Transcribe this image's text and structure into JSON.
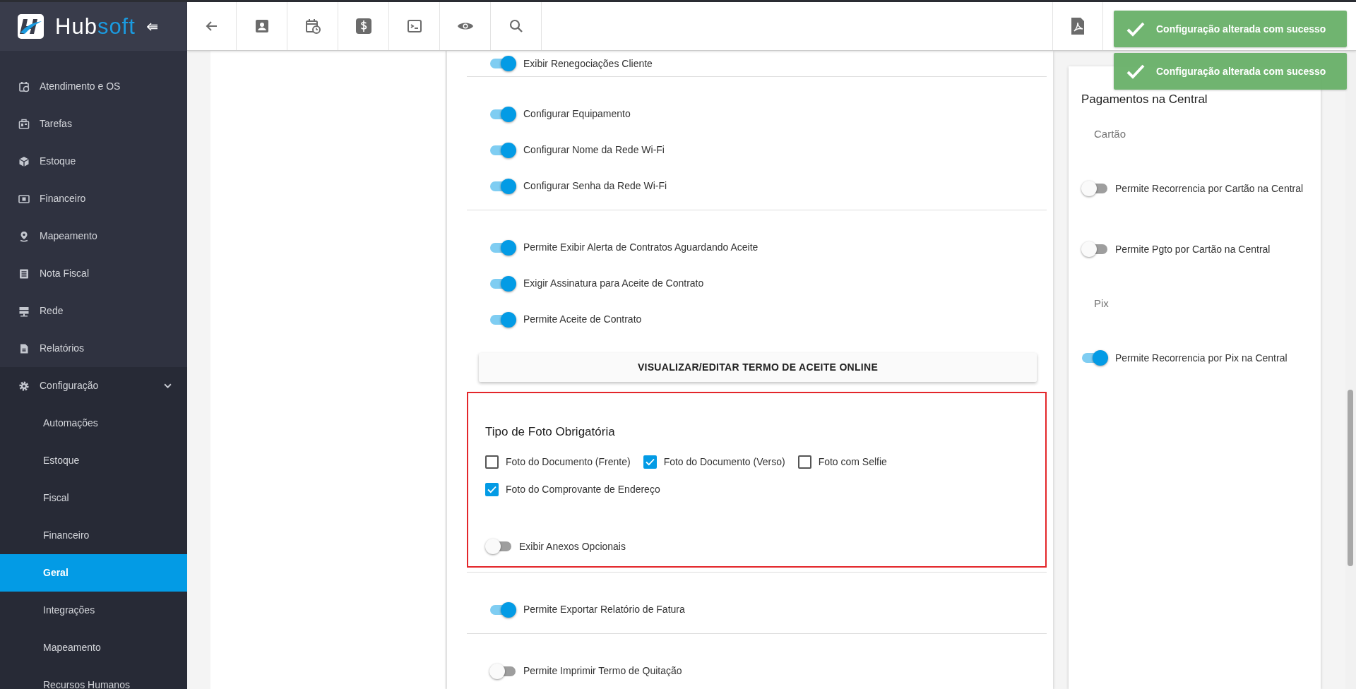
{
  "logo": {
    "part_1": "Hub",
    "part_2": "soft"
  },
  "sidebar": {
    "items": [
      {
        "label": "Atendimento e OS"
      },
      {
        "label": "Tarefas"
      },
      {
        "label": "Estoque"
      },
      {
        "label": "Financeiro"
      },
      {
        "label": "Mapeamento"
      },
      {
        "label": "Nota Fiscal"
      },
      {
        "label": "Rede"
      },
      {
        "label": "Relatórios"
      },
      {
        "label": "Configuração",
        "expanded": true,
        "children": [
          {
            "label": "Automações",
            "selected": false
          },
          {
            "label": "Estoque",
            "selected": false
          },
          {
            "label": "Fiscal",
            "selected": false
          },
          {
            "label": "Financeiro",
            "selected": false
          },
          {
            "label": "Geral",
            "selected": true
          },
          {
            "label": "Integrações",
            "selected": false
          },
          {
            "label": "Mapeamento",
            "selected": false
          },
          {
            "label": "Recursos Humanos",
            "selected": false
          }
        ]
      }
    ]
  },
  "toasts": [
    {
      "message": "Configuração alterada com sucesso"
    },
    {
      "message": "Configuração alterada com sucesso"
    }
  ],
  "settings": {
    "sections": [
      {
        "kind": "toggle_group",
        "items": [
          {
            "label": "Exibir Renegociações Cliente",
            "on": true
          }
        ]
      },
      {
        "kind": "toggle_group",
        "items": [
          {
            "label": "Configurar Equipamento",
            "on": true
          },
          {
            "label": "Configurar Nome da Rede Wi-Fi",
            "on": true
          },
          {
            "label": "Configurar Senha da Rede Wi-Fi",
            "on": true
          }
        ]
      },
      {
        "kind": "toggle_group",
        "items": [
          {
            "label": "Permite Exibir Alerta de Contratos Aguardando Aceite",
            "on": true
          },
          {
            "label": "Exigir Assinatura para Aceite de Contrato",
            "on": true
          },
          {
            "label": "Permite Aceite de Contrato",
            "on": true
          }
        ]
      },
      {
        "kind": "button",
        "label": "VISUALIZAR/EDITAR TERMO DE ACEITE ONLINE"
      },
      {
        "kind": "photo_requirements",
        "highlighted": true,
        "title": "Tipo de Foto Obrigatória",
        "options": [
          {
            "label": "Foto do Documento (Frente)",
            "checked": false
          },
          {
            "label": "Foto do Documento (Verso)",
            "checked": true
          },
          {
            "label": "Foto com Selfie",
            "checked": false
          },
          {
            "label": "Foto do Comprovante de Endereço",
            "checked": true
          }
        ],
        "toggle": {
          "label": "Exibir Anexos Opcionais",
          "on": false
        }
      },
      {
        "kind": "toggle_group",
        "items": [
          {
            "label": "Permite Exportar Relatório de Fatura",
            "on": true
          }
        ]
      },
      {
        "kind": "toggle_group",
        "items": [
          {
            "label": "Permite Imprimir Termo de Quitação",
            "on": false
          }
        ]
      }
    ]
  },
  "payments": {
    "title": "Pagamentos na Central",
    "sections": [
      {
        "heading": "Cartão",
        "toggles": [
          {
            "label": "Permite Recorrencia por Cartão na Central",
            "on": false
          },
          {
            "label": "Permite Pgto por Cartão na Central",
            "on": false
          }
        ]
      },
      {
        "heading": "Pix",
        "toggles": [
          {
            "label": "Permite Recorrencia por Pix na Central",
            "on": true
          }
        ]
      }
    ]
  }
}
